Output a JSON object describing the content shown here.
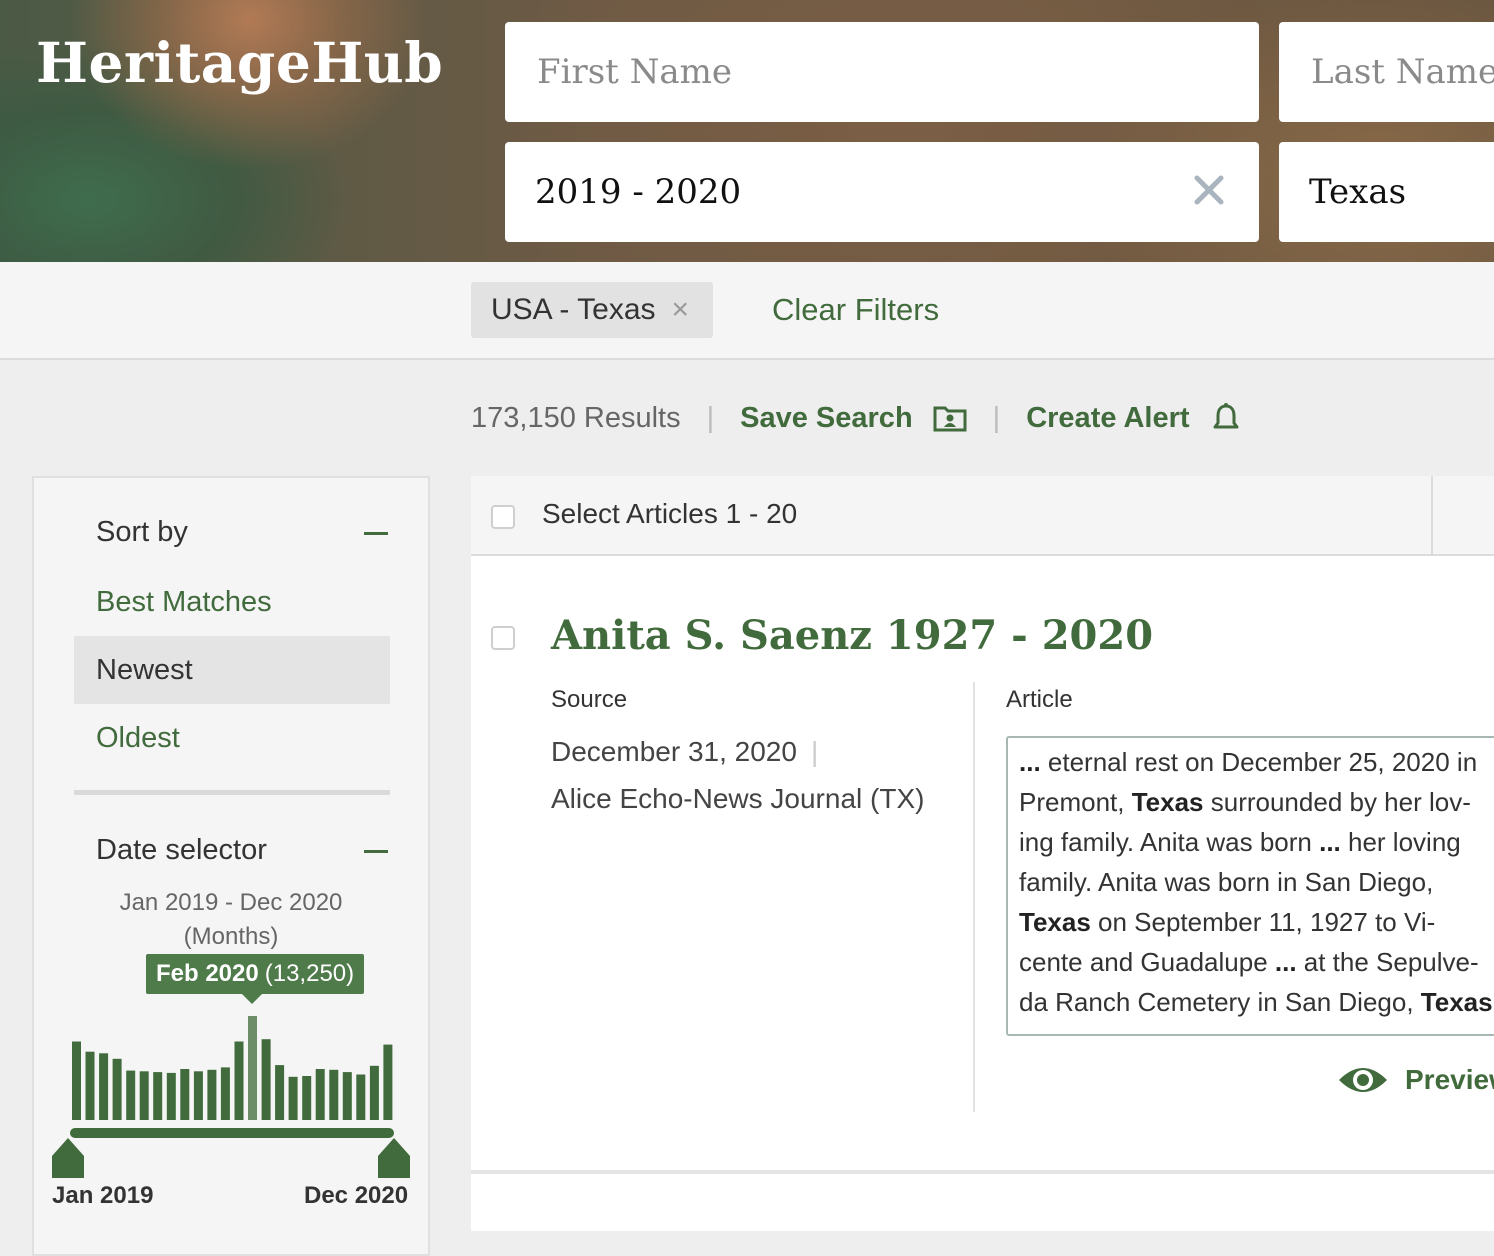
{
  "brand": {
    "logo": "HeritageHub"
  },
  "search": {
    "first_name_placeholder": "First Name",
    "last_name_placeholder": "Last Name",
    "date_range": "2019 - 2020",
    "location": "Texas"
  },
  "filters": {
    "chip_label": "USA - Texas",
    "chip_remove": "×",
    "clear_label": "Clear Filters"
  },
  "results": {
    "count": "173,150 Results",
    "separator": "|",
    "save_search": "Save Search",
    "create_alert": "Create Alert"
  },
  "sidebar": {
    "sort": {
      "title": "Sort by",
      "options": [
        {
          "label": "Best Matches",
          "active": false
        },
        {
          "label": "Newest",
          "active": true
        },
        {
          "label": "Oldest",
          "active": false
        }
      ]
    },
    "date_selector": {
      "title": "Date selector",
      "range_line1": "Jan 2019 - Dec 2020",
      "range_line2": "(Months)",
      "tooltip_month": "Feb 2020",
      "tooltip_count": "(13,250)",
      "start_label": "Jan 2019",
      "end_label": "Dec 2020"
    }
  },
  "list": {
    "select_label": "Select Articles 1 - 20",
    "items": [
      {
        "title": "Anita S. Saenz 1927 - 2020",
        "source_label": "Source",
        "article_label": "Article",
        "date": "December 31, 2020",
        "date_sep": "|",
        "publication": "Alice Echo-News Journal (TX)",
        "snippet_lines": [
          "... eternal rest on December 25, 2020 in",
          "Premont, Texas surrounded by her lov-",
          "ing family. Anita was born ... her loving",
          "family. Anita was born in San Diego,",
          "Texas on September 11, 1927 to Vi-",
          "cente and Guadalupe ... at the Sepulve-",
          "da Ranch Cemetery in San Diego, Texas"
        ],
        "preview_label": "Preview"
      }
    ]
  },
  "chart_data": {
    "type": "bar",
    "categories": [
      "Jan 2019",
      "Feb 2019",
      "Mar 2019",
      "Apr 2019",
      "May 2019",
      "Jun 2019",
      "Jul 2019",
      "Aug 2019",
      "Sep 2019",
      "Oct 2019",
      "Nov 2019",
      "Dec 2019",
      "Jan 2020",
      "Feb 2020",
      "Mar 2020",
      "Apr 2020",
      "May 2020",
      "Jun 2020",
      "Jul 2020",
      "Aug 2020",
      "Sep 2020",
      "Oct 2020",
      "Nov 2020",
      "Dec 2020"
    ],
    "values": [
      10000,
      8700,
      8500,
      7800,
      6300,
      6200,
      6100,
      6000,
      6500,
      6200,
      6400,
      6700,
      10000,
      13250,
      10300,
      7000,
      5500,
      5600,
      6500,
      6400,
      6100,
      5800,
      6900,
      9600
    ],
    "highlighted": "Feb 2020",
    "colors": {
      "bar": "#416b3c",
      "highlight": "#6d8c68"
    }
  },
  "colors": {
    "accent": "#416b3c",
    "text": "#333333"
  }
}
